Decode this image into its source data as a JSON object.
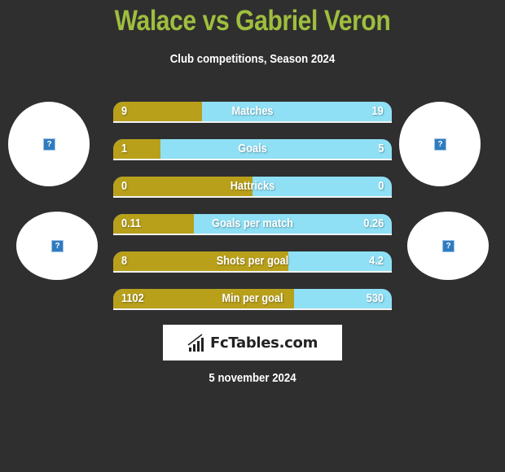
{
  "header": {
    "title": "Walace vs Gabriel Veron",
    "subtitle": "Club competitions, Season 2024"
  },
  "players": {
    "left": {
      "name": "Walace",
      "photo_icon": "broken-image-icon",
      "club_icon": "broken-image-icon"
    },
    "right": {
      "name": "Gabriel Veron",
      "photo_icon": "broken-image-icon",
      "club_icon": "broken-image-icon"
    }
  },
  "icon_glyph": "?",
  "colors": {
    "title": "#9fbe3e",
    "left_fill": "#b8a01a",
    "right_fill": "#8fe0f5",
    "background": "#2f2f2f"
  },
  "stats": [
    {
      "label": "Matches",
      "left": "9",
      "right": "19",
      "left_share": 0.32
    },
    {
      "label": "Goals",
      "left": "1",
      "right": "5",
      "left_share": 0.17
    },
    {
      "label": "Hattricks",
      "left": "0",
      "right": "0",
      "left_share": 0.5
    },
    {
      "label": "Goals per match",
      "left": "0.11",
      "right": "0.26",
      "left_share": 0.29
    },
    {
      "label": "Shots per goal",
      "left": "8",
      "right": "4.2",
      "left_share": 0.63
    },
    {
      "label": "Min per goal",
      "left": "1102",
      "right": "530",
      "left_share": 0.65
    }
  ],
  "branding": {
    "logo_text": "FcTables.com",
    "logo_icon": "bar-chart-icon"
  },
  "footer": {
    "date": "5 november 2024"
  }
}
